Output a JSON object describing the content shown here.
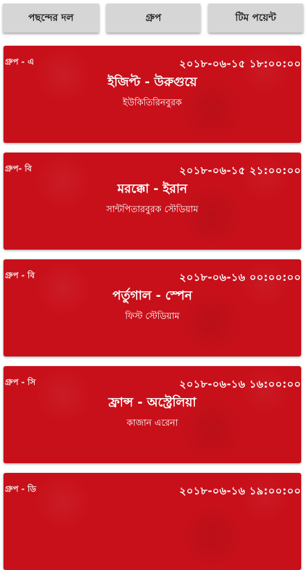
{
  "tabs": [
    {
      "label": "পছন্দের দল"
    },
    {
      "label": "গ্রুপ"
    },
    {
      "label": "টিম পয়েন্ট"
    }
  ],
  "matches": [
    {
      "group": "গ্রুপ - এ",
      "datetime": "২০১৮-০৬-১৫ ১৮:০০:০০",
      "teams": "ইজিপ্ট - উরুগুয়ে",
      "venue": "ইউকিতিরিনবুরক"
    },
    {
      "group": "গ্রুপ- বি",
      "datetime": "২০১৮-০৬-১৫ ২১:০০:০০",
      "teams": "মরক্কো - ইরান",
      "venue": "সান্টপিতারবুরক স্টেডিয়াম"
    },
    {
      "group": "গ্রুপ - বি",
      "datetime": "২০১৮-০৬-১৬ ০০:০০:০০",
      "teams": "পর্তুগাল - স্পেন",
      "venue": "ফিস্ট স্টেডিয়াম"
    },
    {
      "group": "গ্রুপ - সি",
      "datetime": "২০১৮-০৬-১৬ ১৬:০০:০০",
      "teams": "ফ্রান্স - অস্ট্রেলিয়া",
      "venue": "কাজান এরেনা"
    },
    {
      "group": "গ্রুপ - ডি",
      "datetime": "২০১৮-০৬-১৬ ১৯:০০:০০",
      "teams": "",
      "venue": ""
    }
  ],
  "colors": {
    "card_red": "#c8101a",
    "tab_grey": "#d6d6d6"
  }
}
